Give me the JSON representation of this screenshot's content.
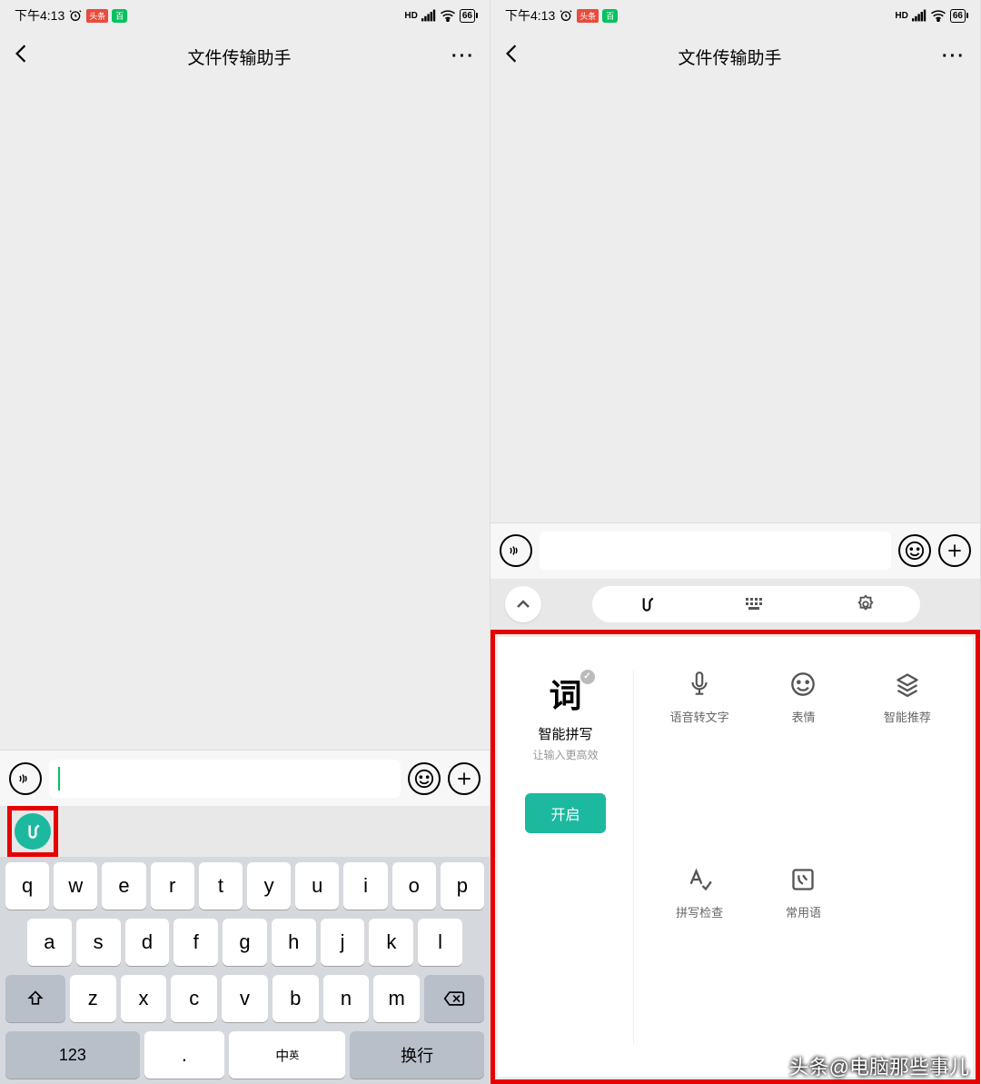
{
  "status": {
    "time": "下午4:13",
    "battery": "66",
    "hd_label": "HD"
  },
  "nav": {
    "title": "文件传输助手"
  },
  "keyboard": {
    "row1": [
      "q",
      "w",
      "e",
      "r",
      "t",
      "y",
      "u",
      "i",
      "o",
      "p"
    ],
    "row2": [
      "a",
      "s",
      "d",
      "f",
      "g",
      "h",
      "j",
      "k",
      "l"
    ],
    "row3": [
      "z",
      "x",
      "c",
      "v",
      "b",
      "n",
      "m"
    ],
    "num_label": "123",
    "dot_label": ".",
    "lang_label": "中",
    "lang_sub": "英",
    "enter_label": "换行"
  },
  "panel": {
    "word": "词",
    "title": "智能拼写",
    "subtitle": "让输入更高效",
    "enable": "开启",
    "features": {
      "voice": "语音转文字",
      "emoji": "表情",
      "smart_rec": "智能推荐",
      "spell_check": "拼写检查",
      "common": "常用语"
    }
  },
  "watermark": "头条@电脑那些事儿"
}
